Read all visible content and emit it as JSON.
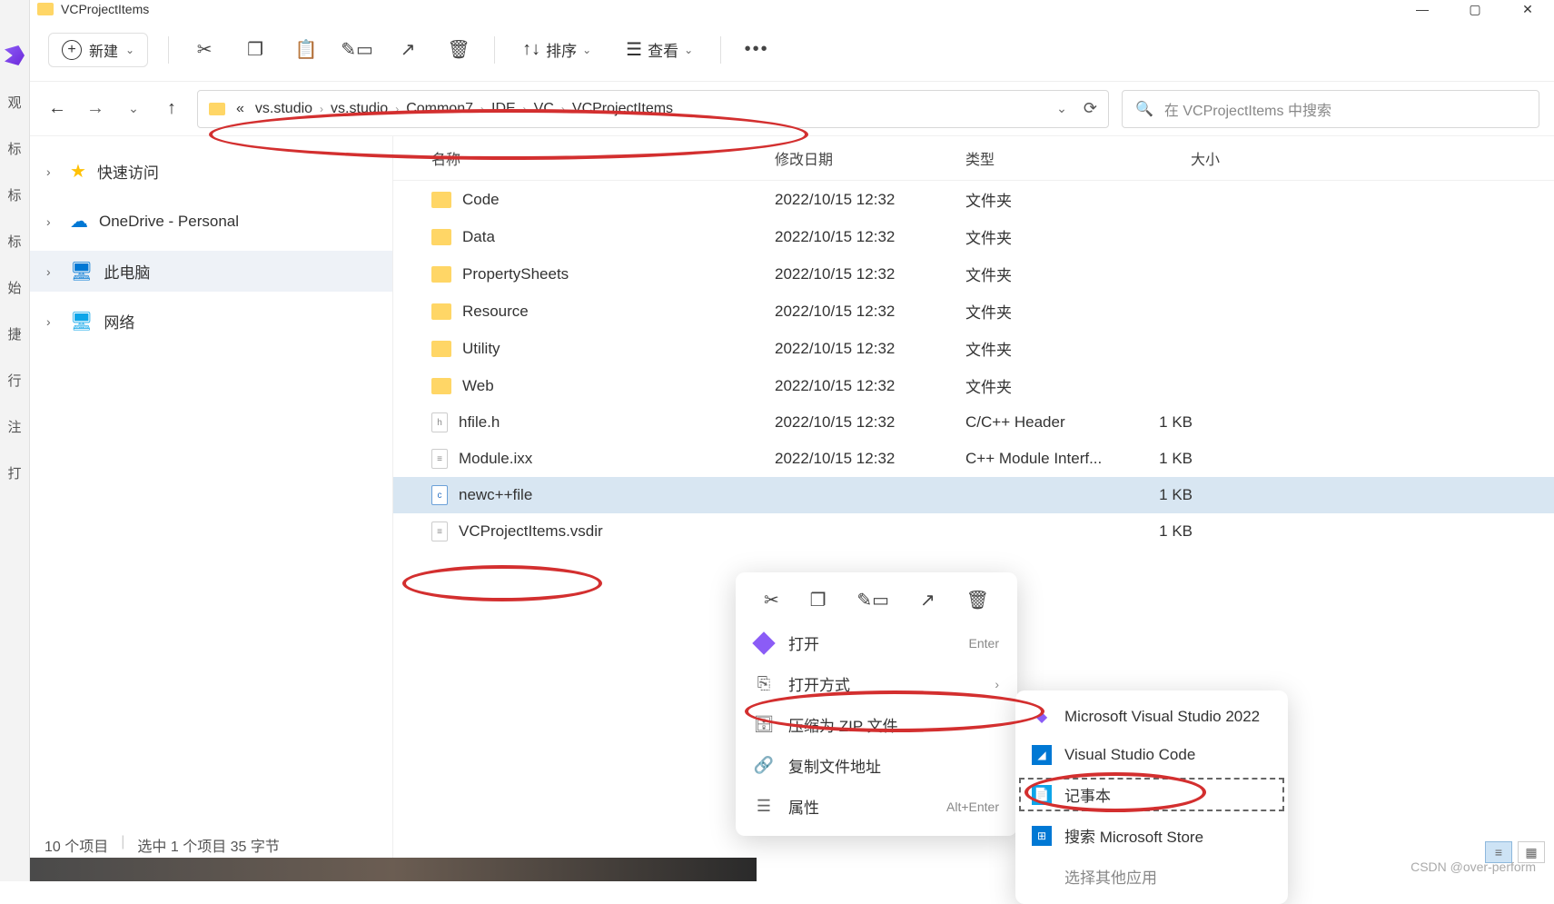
{
  "left_strip": [
    "观",
    "标",
    "标",
    "标",
    "始",
    "捷",
    "行",
    "注",
    "打"
  ],
  "titlebar": {
    "title": "VCProjectItems"
  },
  "win_controls": {
    "min": "—",
    "max": "▢",
    "close": "✕"
  },
  "toolbar": {
    "new_label": "新建",
    "sort_label": "排序",
    "view_label": "查看"
  },
  "breadcrumb": {
    "overflow": "«",
    "items": [
      "vs.studio",
      "vs.studio",
      "Common7",
      "IDE",
      "VC",
      "VCProjectItems"
    ]
  },
  "search": {
    "placeholder": "在 VCProjectItems 中搜索"
  },
  "nav_pane": {
    "quick": "快速访问",
    "onedrive": "OneDrive - Personal",
    "pc": "此电脑",
    "network": "网络"
  },
  "columns": {
    "name": "名称",
    "date": "修改日期",
    "type": "类型",
    "size": "大小"
  },
  "files": [
    {
      "icon": "folder",
      "name": "Code",
      "date": "2022/10/15 12:32",
      "type": "文件夹",
      "size": ""
    },
    {
      "icon": "folder",
      "name": "Data",
      "date": "2022/10/15 12:32",
      "type": "文件夹",
      "size": ""
    },
    {
      "icon": "folder",
      "name": "PropertySheets",
      "date": "2022/10/15 12:32",
      "type": "文件夹",
      "size": ""
    },
    {
      "icon": "folder",
      "name": "Resource",
      "date": "2022/10/15 12:32",
      "type": "文件夹",
      "size": ""
    },
    {
      "icon": "folder",
      "name": "Utility",
      "date": "2022/10/15 12:32",
      "type": "文件夹",
      "size": ""
    },
    {
      "icon": "folder",
      "name": "Web",
      "date": "2022/10/15 12:32",
      "type": "文件夹",
      "size": ""
    },
    {
      "icon": "h",
      "name": "hfile.h",
      "date": "2022/10/15 12:32",
      "type": "C/C++ Header",
      "size": "1 KB"
    },
    {
      "icon": "file",
      "name": "Module.ixx",
      "date": "2022/10/15 12:32",
      "type": "C++ Module Interf...",
      "size": "1 KB"
    },
    {
      "icon": "cpp",
      "name": "newc++file",
      "date": "",
      "type": "",
      "size": "1 KB",
      "selected": true
    },
    {
      "icon": "file",
      "name": "VCProjectItems.vsdir",
      "date": "",
      "type": "",
      "size": "1 KB"
    }
  ],
  "status": {
    "items": "10 个项目",
    "selected": "选中 1 个项目  35 字节"
  },
  "context_menu": {
    "open": "打开",
    "open_shortcut": "Enter",
    "open_with": "打开方式",
    "compress": "压缩为 ZIP 文件",
    "copy_path": "复制文件地址",
    "properties": "属性",
    "properties_shortcut": "Alt+Enter"
  },
  "submenu": {
    "vs2022": "Microsoft Visual Studio 2022",
    "vscode": "Visual Studio Code",
    "notepad": "记事本",
    "msstore": "搜索 Microsoft Store",
    "choose_other": "选择其他应用"
  },
  "watermark": "CSDN @over-perform"
}
